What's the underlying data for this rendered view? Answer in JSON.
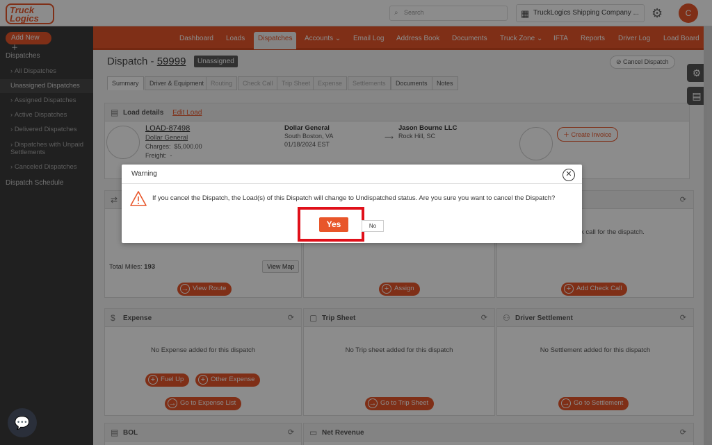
{
  "header": {
    "logo": "Truck Logics",
    "search_placeholder": "Search",
    "company": "TruckLogics Shipping Company ...",
    "avatar_initial": "C"
  },
  "sidebar": {
    "add_new": "Add New",
    "section": "Dispatches",
    "items": [
      {
        "label": "All Dispatches"
      },
      {
        "label": "Unassigned Dispatches"
      },
      {
        "label": "Assigned Dispatches"
      },
      {
        "label": "Active Dispatches"
      },
      {
        "label": "Delivered Dispatches"
      },
      {
        "label": "Dispatches with Unpaid Settlements"
      },
      {
        "label": "Canceled Dispatches"
      }
    ],
    "schedule": "Dispatch Schedule"
  },
  "nav": {
    "items": [
      "Dashboard",
      "Loads",
      "Dispatches",
      "Accounts",
      "Email Log",
      "Address Book",
      "Documents",
      "Truck Zone",
      "IFTA",
      "Reports",
      "Driver Log",
      "Load Board"
    ]
  },
  "page": {
    "title_prefix": "Dispatch - ",
    "dispatch_number": "59999",
    "status": "Unassigned",
    "cancel_label": "Cancel Dispatch",
    "tabs": [
      "Summary",
      "Driver & Equipment",
      "Routing",
      "Check Call",
      "Trip Sheet",
      "Expense",
      "Settlements",
      "Documents",
      "Notes"
    ]
  },
  "load": {
    "header": "Load details",
    "edit": "Edit Load",
    "number": "LOAD-87498",
    "customer": "Dollar General",
    "charges_label": "Charges:",
    "charges": "$5,000.00",
    "freight_label": "Freight:",
    "freight": "-",
    "origin_name": "Dollar General",
    "origin_city": "South Boston, VA",
    "origin_date": "01/18/2024 EST",
    "dest_name": "Jason Bourne LLC",
    "dest_city": "Rock Hill, SC",
    "create_invoice": "Create Invoice"
  },
  "routing": {
    "total_miles_label": "Total Miles:",
    "total_miles": "193",
    "view_map": "View Map",
    "view_route": "View Route",
    "assign": "Assign",
    "check_call_hint": "eck call for the dispatch.",
    "add_check_call": "Add Check Call"
  },
  "expense": {
    "title": "Expense",
    "empty": "No Expense added for this dispatch",
    "fuel_up": "Fuel Up",
    "other": "Other Expense",
    "go": "Go to Expense List"
  },
  "trip": {
    "title": "Trip Sheet",
    "empty": "No Trip sheet added for this dispatch",
    "go": "Go to Trip Sheet"
  },
  "settlement": {
    "title": "Driver Settlement",
    "empty": "No Settlement added for this dispatch",
    "go": "Go to Settlement"
  },
  "bol": {
    "title": "BOL"
  },
  "revenue": {
    "title": "Net Revenue"
  },
  "modal": {
    "title": "Warning",
    "message": "If you cancel the Dispatch, the Load(s) of this Dispatch will change to Undispatched status. Are you sure you want to cancel the Dispatch?",
    "yes": "Yes",
    "no": "No"
  },
  "colors": {
    "accent": "#e8562a",
    "highlight": "#e0101a",
    "sidebar": "#3b3b3b"
  }
}
